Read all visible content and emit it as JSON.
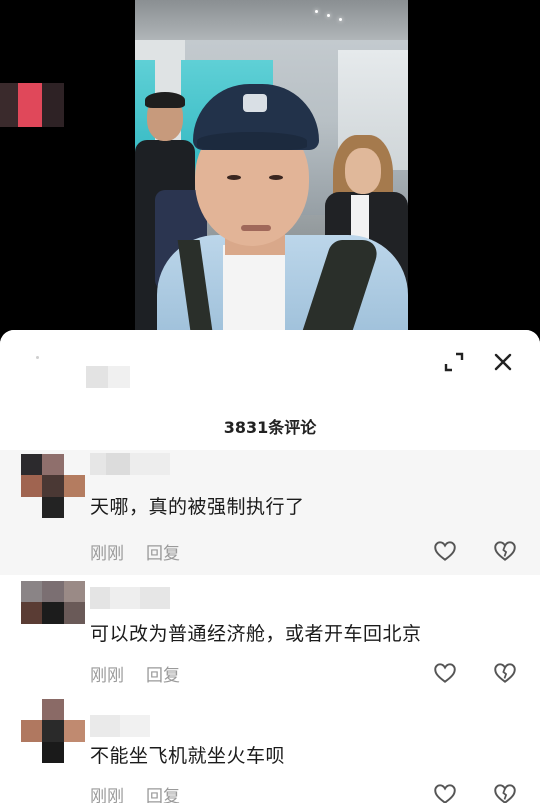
{
  "header": {
    "comment_count_label": "3831条评论"
  },
  "icons": {
    "expand": "expand-icon",
    "close": "close-icon",
    "like": "heart-icon",
    "dislike": "broken-heart-icon"
  },
  "comments": [
    {
      "text": "天哪，真的被强制执行了",
      "time": "刚刚",
      "reply_label": "回复"
    },
    {
      "text": "可以改为普通经济舱，或者开车回北京",
      "time": "刚刚",
      "reply_label": "回复"
    },
    {
      "text": "不能坐飞机就坐火车呗",
      "time": "刚刚",
      "reply_label": "回复"
    }
  ],
  "colors": {
    "sheet_background": "#ffffff",
    "highlight_row": "#f6f6f6",
    "meta_text": "#9a9a9a",
    "body_text": "#1b1b1b"
  }
}
